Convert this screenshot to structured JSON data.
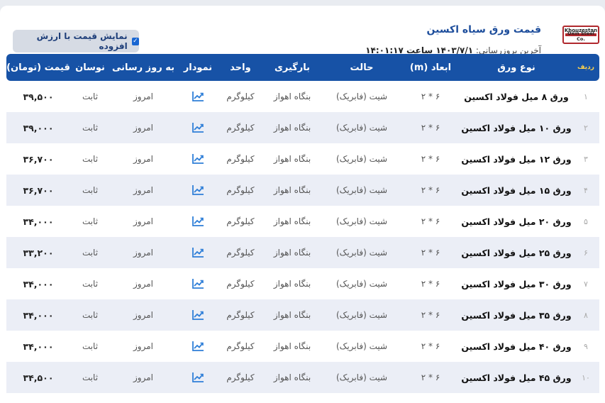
{
  "header": {
    "title": "قیمت ورق سیاه اکسین",
    "updated_label": "آخرین بروزرسانی:",
    "updated_value": "۱۴۰۳/۷/۱ ساعت ۱۴:۰۱:۱۷",
    "logo_top": "Khouzestan",
    "logo_bottom": "Oxin Steel Co."
  },
  "vat_toggle": {
    "label": "نمایش قیمت با ارزش افزوده",
    "checked": true
  },
  "table": {
    "columns": [
      "ردیف",
      "نوع ورق",
      "ابعاد (m)",
      "حالت",
      "بارگیری",
      "واحد",
      "نمودار",
      "به روز رسانی",
      "نوسان",
      "قیمت (تومان)"
    ],
    "rows": [
      {
        "idx": "۱",
        "name": "ورق ۸ میل فولاد اکسین",
        "dims": "۶ * ۲",
        "state": "شیت (فابریک)",
        "loading": "بنگاه اهواز",
        "unit": "کیلوگرم",
        "update": "امروز",
        "change": "ثابت",
        "price": "۳۹,۵۰۰"
      },
      {
        "idx": "۲",
        "name": "ورق ۱۰ میل فولاد اکسین",
        "dims": "۶ * ۲",
        "state": "شیت (فابریک)",
        "loading": "بنگاه اهواز",
        "unit": "کیلوگرم",
        "update": "امروز",
        "change": "ثابت",
        "price": "۳۹,۰۰۰"
      },
      {
        "idx": "۳",
        "name": "ورق ۱۲ میل فولاد اکسین",
        "dims": "۶ * ۲",
        "state": "شیت (فابریک)",
        "loading": "بنگاه اهواز",
        "unit": "کیلوگرم",
        "update": "امروز",
        "change": "ثابت",
        "price": "۳۶,۷۰۰"
      },
      {
        "idx": "۴",
        "name": "ورق ۱۵ میل فولاد اکسین",
        "dims": "۶ * ۲",
        "state": "شیت (فابریک)",
        "loading": "بنگاه اهواز",
        "unit": "کیلوگرم",
        "update": "امروز",
        "change": "ثابت",
        "price": "۳۶,۷۰۰"
      },
      {
        "idx": "۵",
        "name": "ورق ۲۰ میل فولاد اکسین",
        "dims": "۶ * ۲",
        "state": "شیت (فابریک)",
        "loading": "بنگاه اهواز",
        "unit": "کیلوگرم",
        "update": "امروز",
        "change": "ثابت",
        "price": "۳۴,۰۰۰"
      },
      {
        "idx": "۶",
        "name": "ورق ۲۵ میل فولاد اکسین",
        "dims": "۶ * ۲",
        "state": "شیت (فابریک)",
        "loading": "بنگاه اهواز",
        "unit": "کیلوگرم",
        "update": "امروز",
        "change": "ثابت",
        "price": "۳۳,۲۰۰"
      },
      {
        "idx": "۷",
        "name": "ورق ۳۰ میل فولاد اکسین",
        "dims": "۶ * ۲",
        "state": "شیت (فابریک)",
        "loading": "بنگاه اهواز",
        "unit": "کیلوگرم",
        "update": "امروز",
        "change": "ثابت",
        "price": "۳۴,۰۰۰"
      },
      {
        "idx": "۸",
        "name": "ورق ۳۵ میل فولاد اکسین",
        "dims": "۶ * ۲",
        "state": "شیت (فابریک)",
        "loading": "بنگاه اهواز",
        "unit": "کیلوگرم",
        "update": "امروز",
        "change": "ثابت",
        "price": "۳۴,۰۰۰"
      },
      {
        "idx": "۹",
        "name": "ورق ۴۰ میل فولاد اکسین",
        "dims": "۶ * ۲",
        "state": "شیت (فابریک)",
        "loading": "بنگاه اهواز",
        "unit": "کیلوگرم",
        "update": "امروز",
        "change": "ثابت",
        "price": "۳۴,۰۰۰"
      },
      {
        "idx": "۱۰",
        "name": "ورق ۴۵ میل فولاد اکسین",
        "dims": "۶ * ۲",
        "state": "شیت (فابریک)",
        "loading": "بنگاه اهواز",
        "unit": "کیلوگرم",
        "update": "امروز",
        "change": "ثابت",
        "price": "۳۴,۵۰۰"
      }
    ]
  },
  "colors": {
    "header_bg": "#1752a6",
    "title": "#1e4e9c",
    "row_alt": "#ebeef6",
    "chart_icon": "#2f7fd8"
  },
  "icons": {
    "chart": "chart-trend-icon",
    "checkbox": "checkbox-checked-icon",
    "logo": "oxin-logo"
  }
}
